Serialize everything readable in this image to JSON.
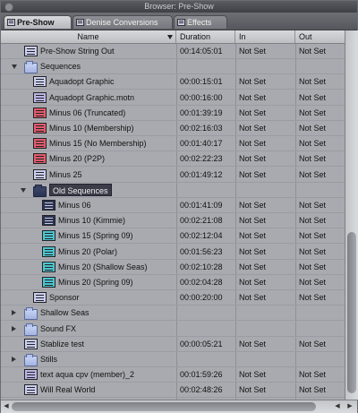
{
  "window": {
    "title": "Browser: Pre-Show"
  },
  "tabs": [
    {
      "label": "Pre-Show",
      "active": true
    },
    {
      "label": "Denise Conversions",
      "active": false
    },
    {
      "label": "Effects",
      "active": false
    }
  ],
  "columns": {
    "name": "Name",
    "duration": "Duration",
    "in": "In",
    "out": "Out"
  },
  "rows": [
    {
      "name": "Pre-Show String Out",
      "duration": "00:14:05:01",
      "in": "Not Set",
      "out": "Not Set",
      "indent": 1,
      "icon": "sequence-icon",
      "iconStyle": "blue",
      "disclosure": "none"
    },
    {
      "name": "Sequences",
      "duration": "",
      "in": "",
      "out": "",
      "indent": 1,
      "icon": "bin-icon",
      "iconStyle": "bin",
      "disclosure": "open"
    },
    {
      "name": "Aquadopt Graphic",
      "duration": "00:00:15:01",
      "in": "Not Set",
      "out": "Not Set",
      "indent": 2,
      "icon": "sequence-icon",
      "iconStyle": "blue",
      "disclosure": "none"
    },
    {
      "name": "Aquadopt Graphic.motn",
      "duration": "00:00:16:00",
      "in": "Not Set",
      "out": "Not Set",
      "indent": 2,
      "icon": "motion-project-icon",
      "iconStyle": "lav",
      "disclosure": "none"
    },
    {
      "name": "Minus 06 (Truncated)",
      "duration": "00:01:39:19",
      "in": "Not Set",
      "out": "Not Set",
      "indent": 2,
      "icon": "sequence-icon",
      "iconStyle": "red",
      "disclosure": "none"
    },
    {
      "name": "Minus 10 (Membership)",
      "duration": "00:02:16:03",
      "in": "Not Set",
      "out": "Not Set",
      "indent": 2,
      "icon": "sequence-icon",
      "iconStyle": "red",
      "disclosure": "none"
    },
    {
      "name": "Minus 15 (No Membership)",
      "duration": "00:01:40:17",
      "in": "Not Set",
      "out": "Not Set",
      "indent": 2,
      "icon": "sequence-icon",
      "iconStyle": "red",
      "disclosure": "none"
    },
    {
      "name": "Minus 20 (P2P)",
      "duration": "00:02:22:23",
      "in": "Not Set",
      "out": "Not Set",
      "indent": 2,
      "icon": "sequence-icon",
      "iconStyle": "red",
      "disclosure": "none"
    },
    {
      "name": "Minus 25",
      "duration": "00:01:49:12",
      "in": "Not Set",
      "out": "Not Set",
      "indent": 2,
      "icon": "sequence-icon",
      "iconStyle": "blue",
      "disclosure": "none"
    },
    {
      "name": "Old Sequences",
      "duration": "",
      "in": "",
      "out": "",
      "indent": 2,
      "icon": "bin-icon",
      "iconStyle": "bindark",
      "disclosure": "open",
      "selected": true
    },
    {
      "name": "Minus 06",
      "duration": "00:01:41:09",
      "in": "Not Set",
      "out": "Not Set",
      "indent": 3,
      "icon": "sequence-icon",
      "iconStyle": "dk",
      "disclosure": "none"
    },
    {
      "name": "Minus 10 (Kimmie)",
      "duration": "00:02:21:08",
      "in": "Not Set",
      "out": "Not Set",
      "indent": 3,
      "icon": "sequence-icon",
      "iconStyle": "dk",
      "disclosure": "none"
    },
    {
      "name": "Minus 15 (Spring 09)",
      "duration": "00:02:12:04",
      "in": "Not Set",
      "out": "Not Set",
      "indent": 3,
      "icon": "sequence-icon",
      "iconStyle": "cyan",
      "disclosure": "none"
    },
    {
      "name": "Minus 20 (Polar)",
      "duration": "00:01:56:23",
      "in": "Not Set",
      "out": "Not Set",
      "indent": 3,
      "icon": "sequence-icon",
      "iconStyle": "cyan",
      "disclosure": "none"
    },
    {
      "name": "Minus 20 (Shallow Seas)",
      "duration": "00:02:10:28",
      "in": "Not Set",
      "out": "Not Set",
      "indent": 3,
      "icon": "sequence-icon",
      "iconStyle": "cyan",
      "disclosure": "none"
    },
    {
      "name": "Minus 20 (Spring 09)",
      "duration": "00:02:04:28",
      "in": "Not Set",
      "out": "Not Set",
      "indent": 3,
      "icon": "sequence-icon",
      "iconStyle": "cyan",
      "disclosure": "none"
    },
    {
      "name": "Sponsor",
      "duration": "00:00:20:00",
      "in": "Not Set",
      "out": "Not Set",
      "indent": 2,
      "icon": "sequence-icon",
      "iconStyle": "blue",
      "disclosure": "none"
    },
    {
      "name": "Shallow Seas",
      "duration": "",
      "in": "",
      "out": "",
      "indent": 1,
      "icon": "bin-icon",
      "iconStyle": "bin",
      "disclosure": "closed"
    },
    {
      "name": "Sound FX",
      "duration": "",
      "in": "",
      "out": "",
      "indent": 1,
      "icon": "bin-icon",
      "iconStyle": "bin",
      "disclosure": "closed"
    },
    {
      "name": "Stablize test",
      "duration": "00:00:05:21",
      "in": "Not Set",
      "out": "Not Set",
      "indent": 1,
      "icon": "sequence-icon",
      "iconStyle": "blue",
      "disclosure": "none"
    },
    {
      "name": "Stills",
      "duration": "",
      "in": "",
      "out": "",
      "indent": 1,
      "icon": "bin-icon",
      "iconStyle": "bin",
      "disclosure": "closed"
    },
    {
      "name": "text aqua cpv (member)_2",
      "duration": "00:01:59:26",
      "in": "Not Set",
      "out": "Not Set",
      "indent": 1,
      "icon": "sequence-icon",
      "iconStyle": "lav",
      "disclosure": "none"
    },
    {
      "name": "Will Real World",
      "duration": "00:02:48:26",
      "in": "Not Set",
      "out": "Not Set",
      "indent": 1,
      "icon": "sequence-icon",
      "iconStyle": "blue",
      "disclosure": "none"
    }
  ]
}
